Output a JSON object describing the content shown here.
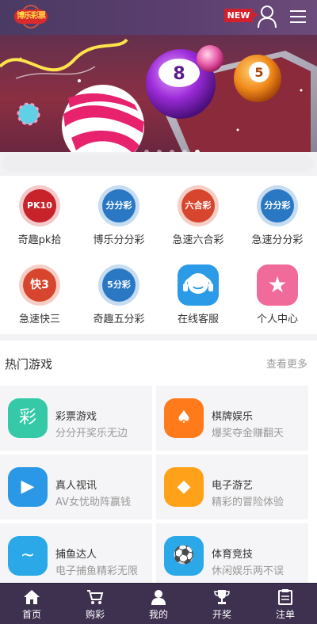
{
  "header": {
    "logo_text": "博乐彩票",
    "new_badge": "NEW",
    "brand_color": "#4a3b63"
  },
  "banner": {
    "ball_numbers": [
      "8",
      "5"
    ],
    "slide_count": 5,
    "active_slide": 4
  },
  "grid": {
    "items": [
      {
        "label": "奇趣pk拾",
        "icon_text": "PK10",
        "icon": "pk10-icon",
        "color": "#c8222a"
      },
      {
        "label": "博乐分分彩",
        "icon_text": "分分彩",
        "icon": "ffc-icon",
        "color": "#2a78c4"
      },
      {
        "label": "急速六合彩",
        "icon_text": "六合彩",
        "icon": "lhc-icon",
        "color": "#d8452e"
      },
      {
        "label": "急速分分彩",
        "icon_text": "分分彩",
        "icon": "jsffc-icon",
        "color": "#2a78c4"
      },
      {
        "label": "急速快三",
        "icon_text": "快3",
        "icon": "k3-icon",
        "color": "#d8452e"
      },
      {
        "label": "奇趣五分彩",
        "icon_text": "5分彩",
        "icon": "wfc-icon",
        "color": "#2a78c4"
      },
      {
        "label": "在线客服",
        "icon_text": "",
        "icon": "headset-icon",
        "color": "#2b9be8"
      },
      {
        "label": "个人中心",
        "icon_text": "★",
        "icon": "star-icon",
        "color": "#f06a9a"
      }
    ]
  },
  "hot": {
    "title": "热门游戏",
    "more": "查看更多",
    "cards": [
      {
        "title": "彩票游戏",
        "subtitle": "分分开奖乐无边",
        "icon": "lottery-icon",
        "color": "#35c9a8",
        "glyph": "彩"
      },
      {
        "title": "棋牌娱乐",
        "subtitle": "爆奖夺金赚翻天",
        "icon": "cards-icon",
        "color": "#ff7a1a",
        "glyph": "♠"
      },
      {
        "title": "真人视讯",
        "subtitle": "AV女忧助阵赢钱",
        "icon": "play-icon",
        "color": "#2a98e6",
        "glyph": "▶"
      },
      {
        "title": "电子游艺",
        "subtitle": "精彩的冒险体验",
        "icon": "ironman-icon",
        "color": "#ffa21a",
        "glyph": "◆"
      },
      {
        "title": "捕鱼达人",
        "subtitle": "电子捕鱼精彩无限",
        "icon": "fish-icon",
        "color": "#2aa8e8",
        "glyph": "~"
      },
      {
        "title": "体育竞技",
        "subtitle": "休闲娱乐两不误",
        "icon": "football-icon",
        "color": "#2aa8e8",
        "glyph": "⚽"
      }
    ]
  },
  "tabbar": {
    "items": [
      {
        "label": "首页",
        "icon": "home-icon"
      },
      {
        "label": "购彩",
        "icon": "cart-icon"
      },
      {
        "label": "我的",
        "icon": "person-icon"
      },
      {
        "label": "开奖",
        "icon": "trophy-icon"
      },
      {
        "label": "注单",
        "icon": "clipboard-icon"
      }
    ]
  }
}
